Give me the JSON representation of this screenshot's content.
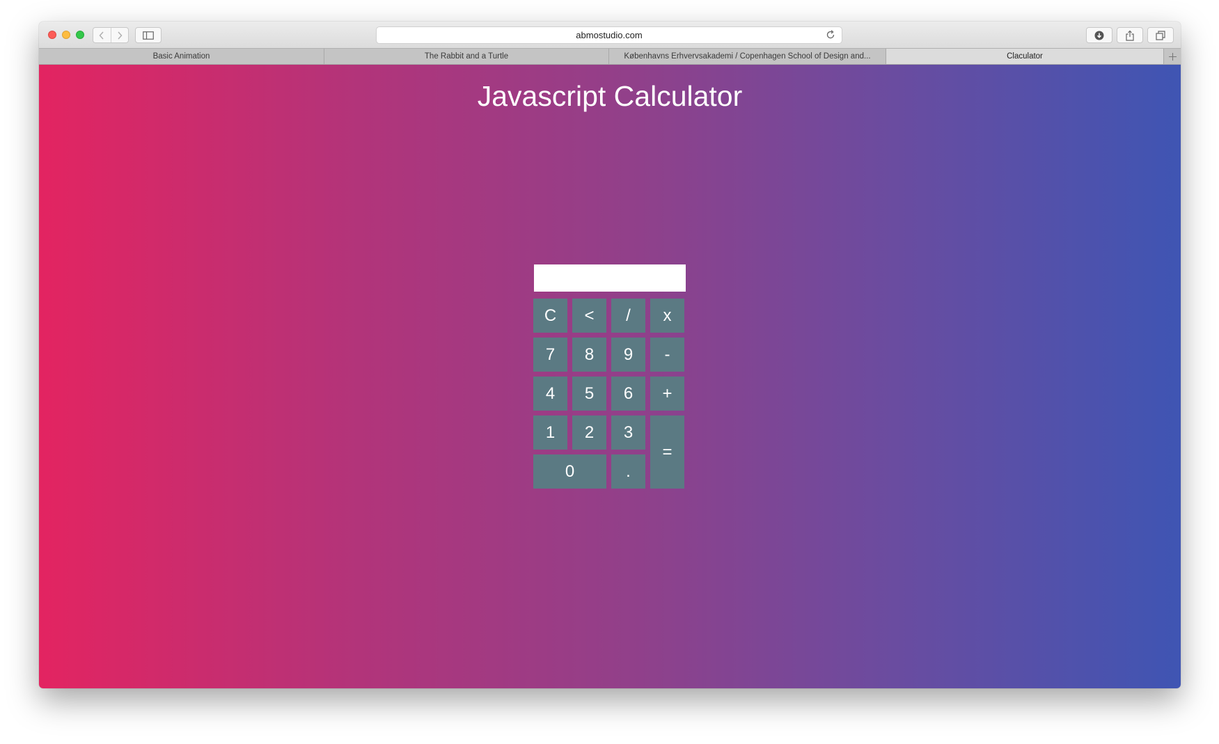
{
  "browser": {
    "address": "abmostudio.com",
    "tabs": [
      {
        "label": "Basic Animation"
      },
      {
        "label": "The Rabbit and a Turtle"
      },
      {
        "label": "Københavns Erhvervsakademi / Copenhagen School of Design and..."
      },
      {
        "label": "Claculator"
      }
    ],
    "active_tab": 3
  },
  "page": {
    "title": "Javascript Calculator"
  },
  "calculator": {
    "display_value": "",
    "keys": {
      "clear": "C",
      "back": "<",
      "divide": "/",
      "multiply": "x",
      "seven": "7",
      "eight": "8",
      "nine": "9",
      "minus": "-",
      "four": "4",
      "five": "5",
      "six": "6",
      "plus": "+",
      "one": "1",
      "two": "2",
      "three": "3",
      "equals": "=",
      "zero": "0",
      "decimal": "."
    }
  },
  "colors": {
    "gradient_start": "#e32461",
    "gradient_end": "#3f55b3",
    "key_background": "#5b7a83"
  }
}
